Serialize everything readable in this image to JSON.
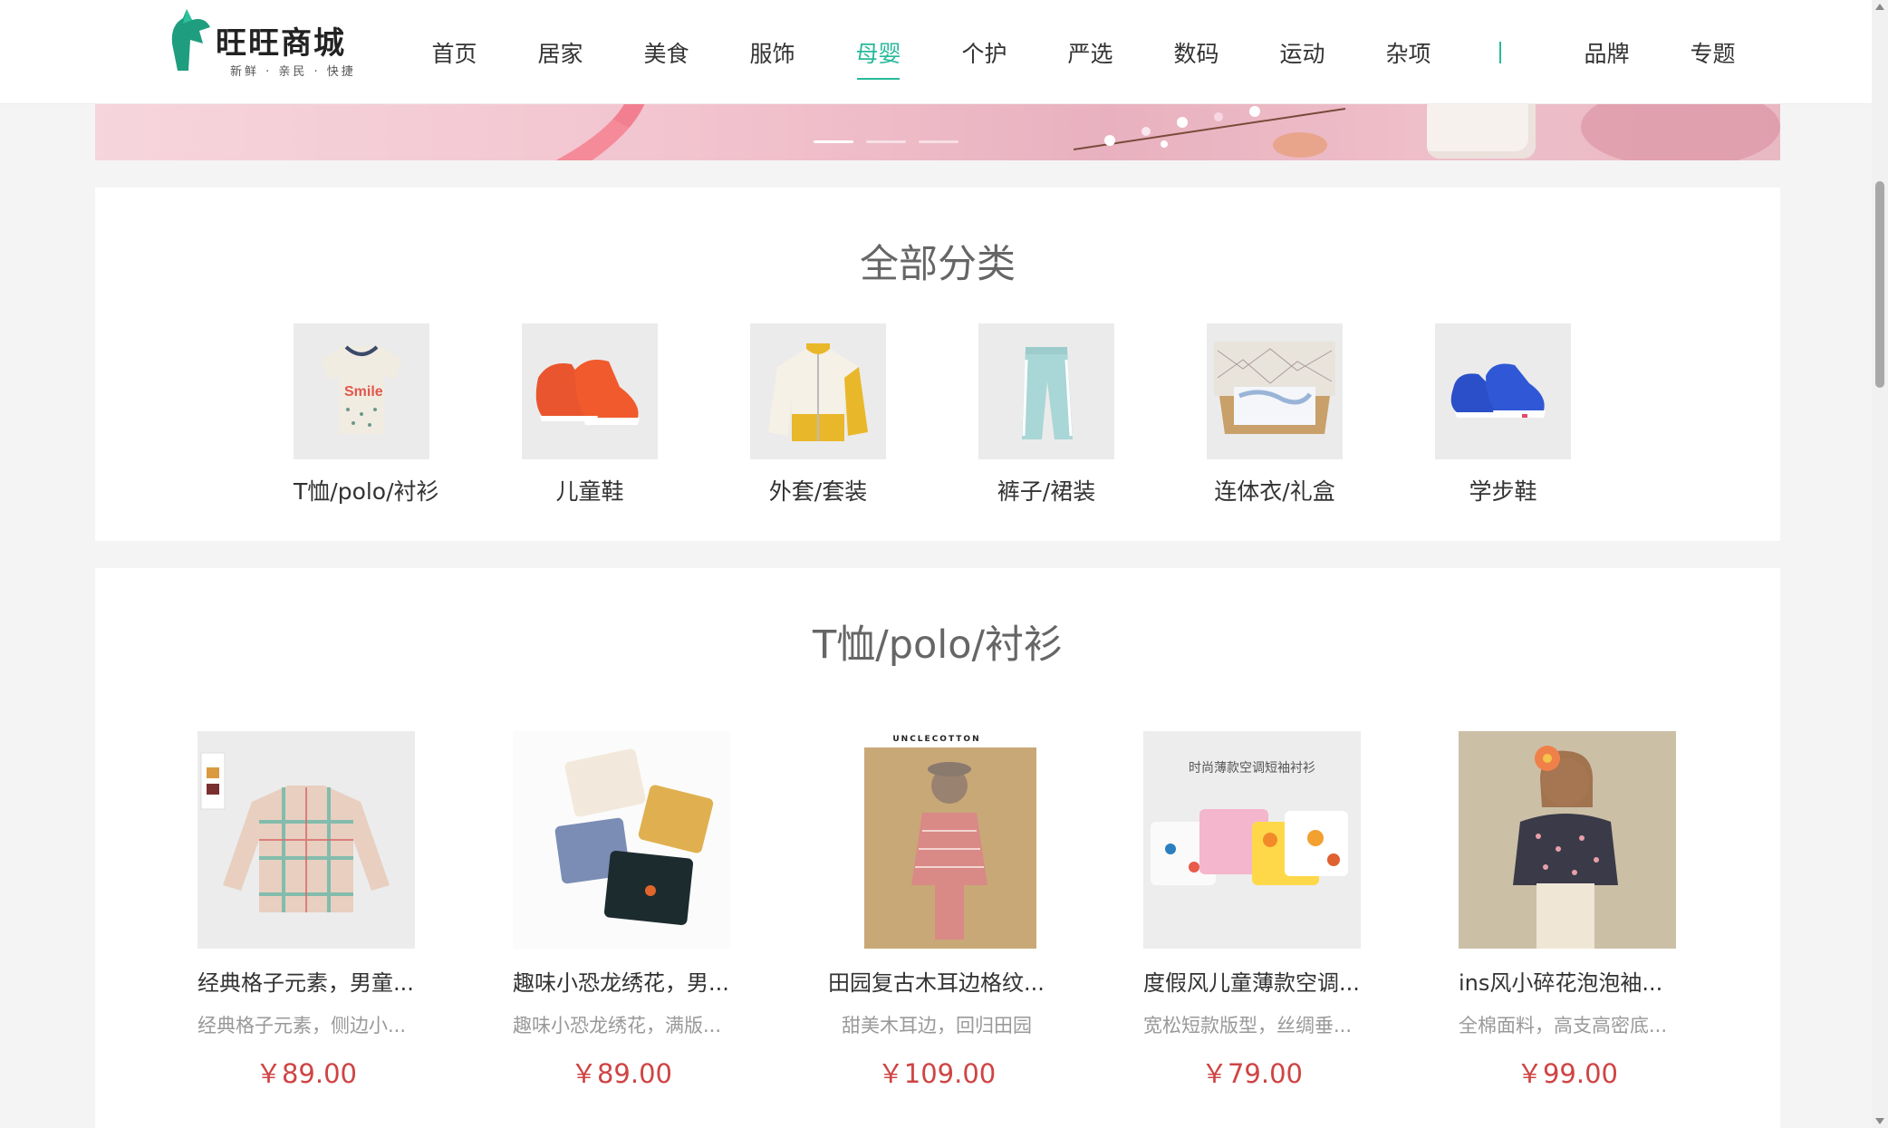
{
  "header": {
    "logo": {
      "name": "旺旺商城",
      "slogan": "新鲜 · 亲民 · 快捷"
    },
    "nav": [
      {
        "label": "首页",
        "active": false
      },
      {
        "label": "居家",
        "active": false
      },
      {
        "label": "美食",
        "active": false
      },
      {
        "label": "服饰",
        "active": false
      },
      {
        "label": "母婴",
        "active": true
      },
      {
        "label": "个护",
        "active": false
      },
      {
        "label": "严选",
        "active": false
      },
      {
        "label": "数码",
        "active": false
      },
      {
        "label": "运动",
        "active": false
      },
      {
        "label": "杂项",
        "active": false
      }
    ],
    "nav_extra": [
      {
        "label": "品牌"
      },
      {
        "label": "专题"
      }
    ]
  },
  "categories": {
    "title": "全部分类",
    "items": [
      {
        "label": "T恤/polo/衬衫",
        "icon": "tshirt-image"
      },
      {
        "label": "儿童鞋",
        "icon": "kids-shoes-image"
      },
      {
        "label": "外套/套装",
        "icon": "jacket-image"
      },
      {
        "label": "裤子/裙装",
        "icon": "pants-image"
      },
      {
        "label": "连体衣/礼盒",
        "icon": "gift-box-image"
      },
      {
        "label": "学步鞋",
        "icon": "baby-shoes-image"
      }
    ]
  },
  "products": {
    "title": "T恤/polo/衬衫",
    "items": [
      {
        "name": "经典格子元素，男童...",
        "desc": "经典格子元素，侧边小...",
        "price": "￥89.00"
      },
      {
        "name": "趣味小恐龙绣花，男...",
        "desc": "趣味小恐龙绣花，满版...",
        "price": "￥89.00"
      },
      {
        "name": "田园复古木耳边格纹...",
        "desc": "甜美木耳边，回归田园",
        "price": "￥109.00",
        "badge": "UNCLECOTTON"
      },
      {
        "name": "度假风儿童薄款空调...",
        "desc": "宽松短款版型，丝绸垂...",
        "price": "￥79.00",
        "overlay": "时尚薄款空调短袖衬衫"
      },
      {
        "name": "ins风小碎花泡泡袖...",
        "desc": "全棉面料，高支高密底...",
        "price": "￥99.00"
      }
    ]
  },
  "colors": {
    "brand": "#27ba9b",
    "price": "#cf4444"
  }
}
